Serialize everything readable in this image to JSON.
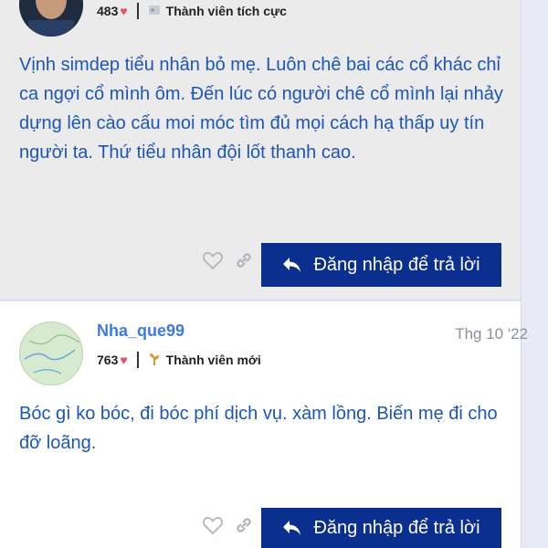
{
  "post1": {
    "score": "483",
    "rank": "Thành viên tích cực",
    "rank_icon": "badge-icon",
    "content": "Vịnh simdep tiểu nhân bỏ mẹ. Luôn chê bai các cổ khác chỉ ca ngợi cổ mình ôm. Đến lúc có người chê cổ mình lại nhảy dựng lên cào cấu moi móc tìm đủ mọi cách hạ thấp uy tín người ta. Thứ tiểu nhân đội lốt thanh cao.",
    "reply_label": "Đăng nhập để trả lời"
  },
  "post2": {
    "username": "Nha_que99",
    "date": "Thg 10 '22",
    "score": "763",
    "rank": "Thành viên mới",
    "rank_icon": "sprout-icon",
    "content": "Bóc gì ko bóc, đi bóc phí dịch vụ. xàm lồng. Biến mẹ đi cho đỡ loãng.",
    "reply_label": "Đăng nhập để trả lời"
  },
  "colors": {
    "accent": "#0b2f8f",
    "username": "#3c7be0",
    "content_text": "#1d56b8",
    "heart": "#e54f6d"
  }
}
